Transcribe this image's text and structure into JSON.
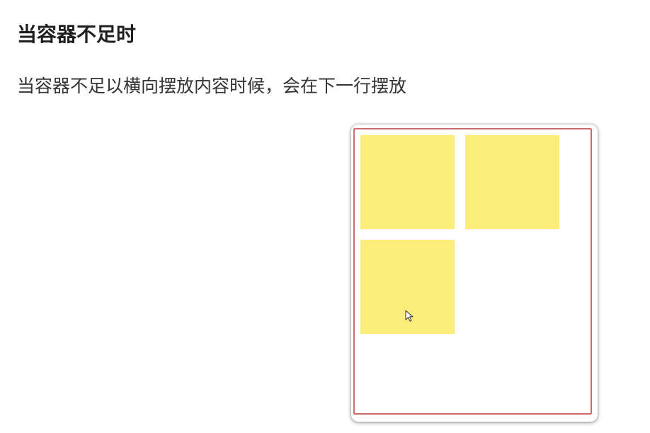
{
  "content": {
    "heading": "当容器不足时",
    "description": "当容器不足以横向摆放内容时候，会在下一行摆放"
  },
  "demo": {
    "items_count": 3,
    "item_color": "#fcec79",
    "container_border_color": "#cf6b6b"
  },
  "icons": {
    "cursor": "mouse-pointer-icon"
  }
}
